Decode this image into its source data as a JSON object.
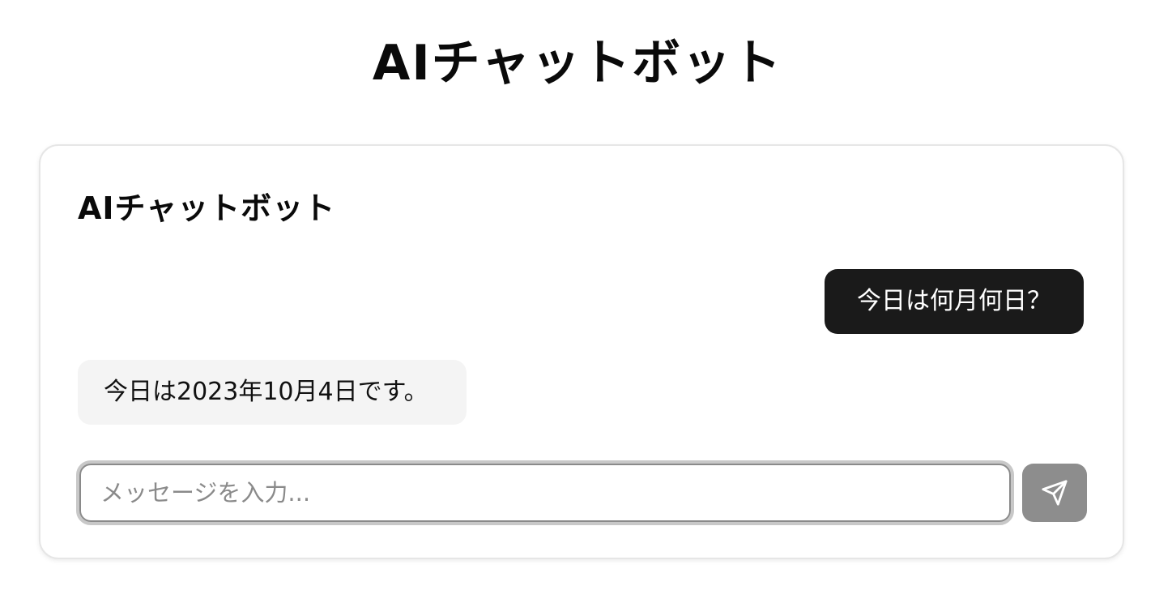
{
  "page": {
    "title": "AIチャットボット"
  },
  "chat": {
    "title": "AIチャットボット",
    "messages": [
      {
        "role": "user",
        "text": "今日は何月何日？"
      },
      {
        "role": "assistant",
        "text": "今日は2023年10月4日です。"
      }
    ],
    "input": {
      "value": "",
      "placeholder": "メッセージを入力..."
    },
    "send_button": {
      "icon": "send-icon",
      "color": "#8d8d8d"
    }
  },
  "colors": {
    "user_bubble": "#1a1a1a",
    "assistant_bubble": "#f4f4f4"
  }
}
